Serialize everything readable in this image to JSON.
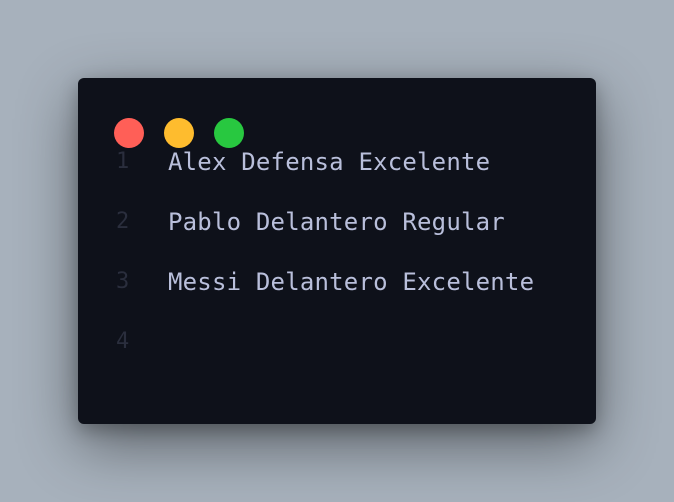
{
  "window": {
    "controls": [
      {
        "name": "close",
        "color": "#ff5f57"
      },
      {
        "name": "minimize",
        "color": "#febc2e"
      },
      {
        "name": "zoom",
        "color": "#28c840"
      }
    ]
  },
  "editor": {
    "lines": [
      {
        "number": "1",
        "text": "Alex Defensa Excelente"
      },
      {
        "number": "2",
        "text": "Pablo Delantero Regular"
      },
      {
        "number": "3",
        "text": "Messi Delantero Excelente"
      },
      {
        "number": "4",
        "text": ""
      }
    ]
  }
}
